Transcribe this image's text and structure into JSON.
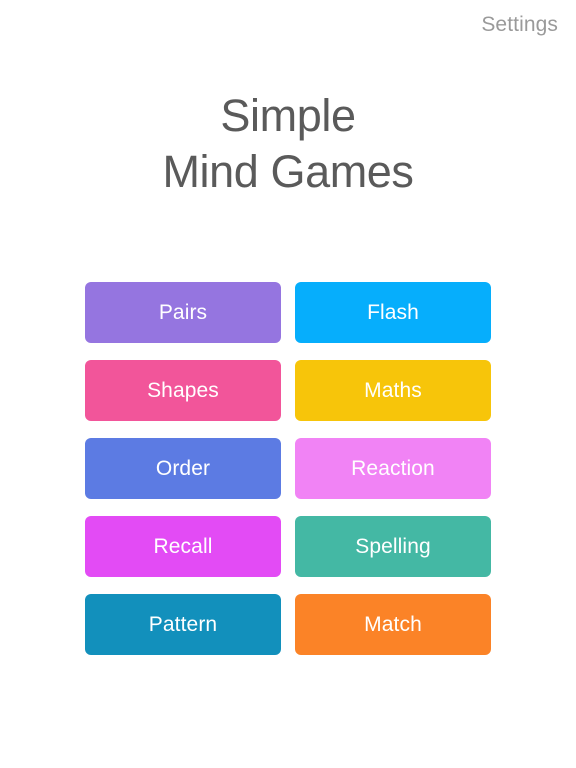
{
  "app": {
    "background_color": "#ffffff"
  },
  "topbar": {
    "settings_label": "Settings",
    "settings_color": "#9a9a9a"
  },
  "title": {
    "line1": "Simple",
    "line2": "Mind Games",
    "color": "#5a5a5a"
  },
  "games": [
    {
      "label": "Pairs",
      "color": "#9575e0",
      "column": "left",
      "row": 1
    },
    {
      "label": "Flash",
      "color": "#06aefc",
      "column": "right",
      "row": 1
    },
    {
      "label": "Shapes",
      "color": "#f2559a",
      "column": "left",
      "row": 2
    },
    {
      "label": "Maths",
      "color": "#f7c50a",
      "column": "right",
      "row": 2
    },
    {
      "label": "Order",
      "color": "#5c7be3",
      "column": "left",
      "row": 3
    },
    {
      "label": "Reaction",
      "color": "#f183f5",
      "column": "right",
      "row": 3
    },
    {
      "label": "Recall",
      "color": "#e34bf5",
      "column": "left",
      "row": 4
    },
    {
      "label": "Spelling",
      "color": "#44b8a4",
      "column": "right",
      "row": 4
    },
    {
      "label": "Pattern",
      "color": "#1290bc",
      "column": "left",
      "row": 5
    },
    {
      "label": "Match",
      "color": "#fb8327",
      "column": "right",
      "row": 5
    }
  ]
}
